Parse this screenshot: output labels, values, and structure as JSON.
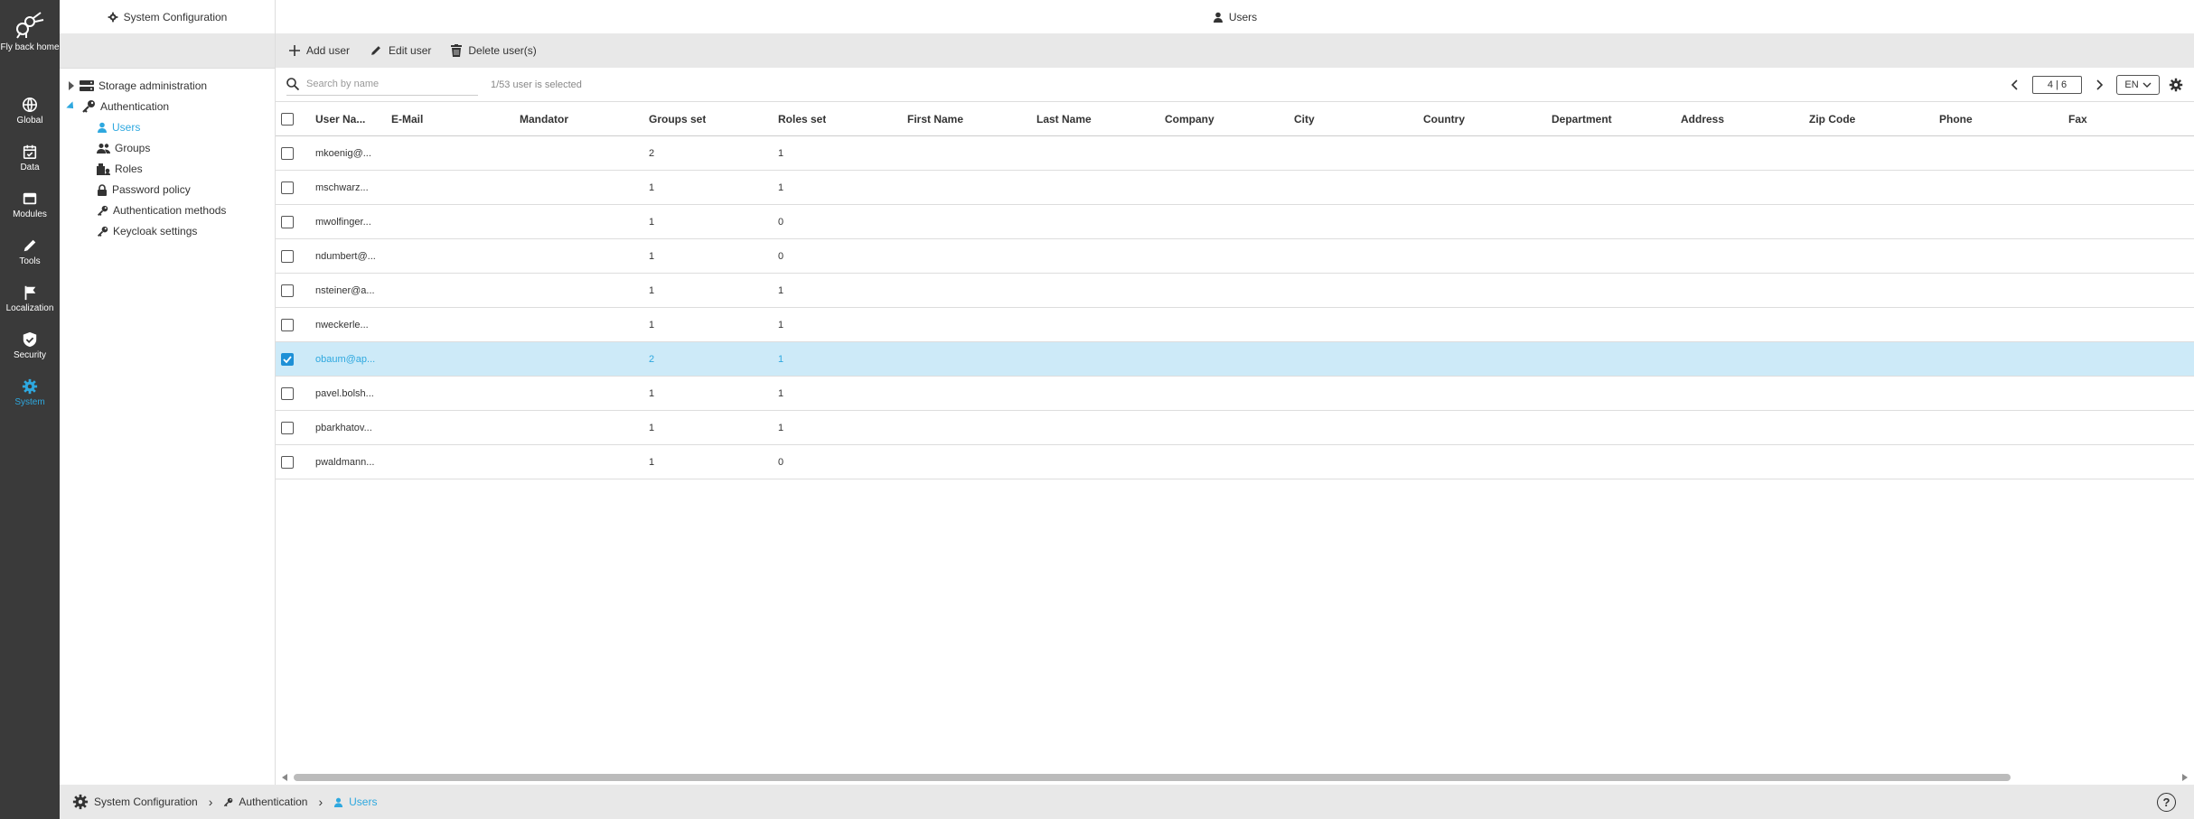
{
  "nav": {
    "logo_label": "Fly back home",
    "items": [
      {
        "label": "Global",
        "icon": "globe-icon"
      },
      {
        "label": "Data",
        "icon": "calendar-check-icon"
      },
      {
        "label": "Modules",
        "icon": "window-icon"
      },
      {
        "label": "Tools",
        "icon": "pencil-icon"
      },
      {
        "label": "Localization",
        "icon": "flag-icon"
      },
      {
        "label": "Security",
        "icon": "shield-icon"
      },
      {
        "label": "System",
        "icon": "gear-icon"
      }
    ],
    "active": "System"
  },
  "tree": {
    "header": "System Configuration",
    "items": [
      {
        "label": "Storage administration",
        "icon": "server-icon"
      },
      {
        "label": "Authentication",
        "icon": "key-icon"
      },
      {
        "label": "Users",
        "icon": "user-icon"
      },
      {
        "label": "Groups",
        "icon": "group-icon"
      },
      {
        "label": "Roles",
        "icon": "roles-icon"
      },
      {
        "label": "Password policy",
        "icon": "lock-icon"
      },
      {
        "label": "Authentication methods",
        "icon": "key-icon"
      },
      {
        "label": "Keycloak settings",
        "icon": "key-icon"
      }
    ]
  },
  "main": {
    "header": "Users",
    "toolbar": {
      "add": "Add user",
      "edit": "Edit user",
      "delete": "Delete user(s)"
    },
    "search": {
      "placeholder": "Search by name",
      "selection_info": "1/53 user is selected"
    },
    "pager": {
      "page": "4 | 6",
      "language": "EN"
    }
  },
  "grid": {
    "columns": [
      "User Na...",
      "E-Mail",
      "Mandator",
      "Groups set",
      "Roles set",
      "First Name",
      "Last Name",
      "Company",
      "City",
      "Country",
      "Department",
      "Address",
      "Zip Code",
      "Phone",
      "Fax"
    ],
    "rows": [
      {
        "user": "mkoenig@...",
        "groups": "2",
        "roles": "1",
        "checked": false
      },
      {
        "user": "mschwarz...",
        "groups": "1",
        "roles": "1",
        "checked": false
      },
      {
        "user": "mwolfinger...",
        "groups": "1",
        "roles": "0",
        "checked": false
      },
      {
        "user": "ndumbert@...",
        "groups": "1",
        "roles": "0",
        "checked": false
      },
      {
        "user": "nsteiner@a...",
        "groups": "1",
        "roles": "1",
        "checked": false
      },
      {
        "user": "nweckerle...",
        "groups": "1",
        "roles": "1",
        "checked": false
      },
      {
        "user": "obaum@ap...",
        "groups": "2",
        "roles": "1",
        "checked": true
      },
      {
        "user": "pavel.bolsh...",
        "groups": "1",
        "roles": "1",
        "checked": false
      },
      {
        "user": "pbarkhatov...",
        "groups": "1",
        "roles": "1",
        "checked": false
      },
      {
        "user": "pwaldmann...",
        "groups": "1",
        "roles": "0",
        "checked": false
      }
    ]
  },
  "footer": {
    "crumbs": [
      "System Configuration",
      "Authentication",
      "Users"
    ],
    "help": "?"
  },
  "colors": {
    "accent": "#2ea8df",
    "nav_bg": "#3a3a3a",
    "selected_row": "#cdeaf8"
  }
}
